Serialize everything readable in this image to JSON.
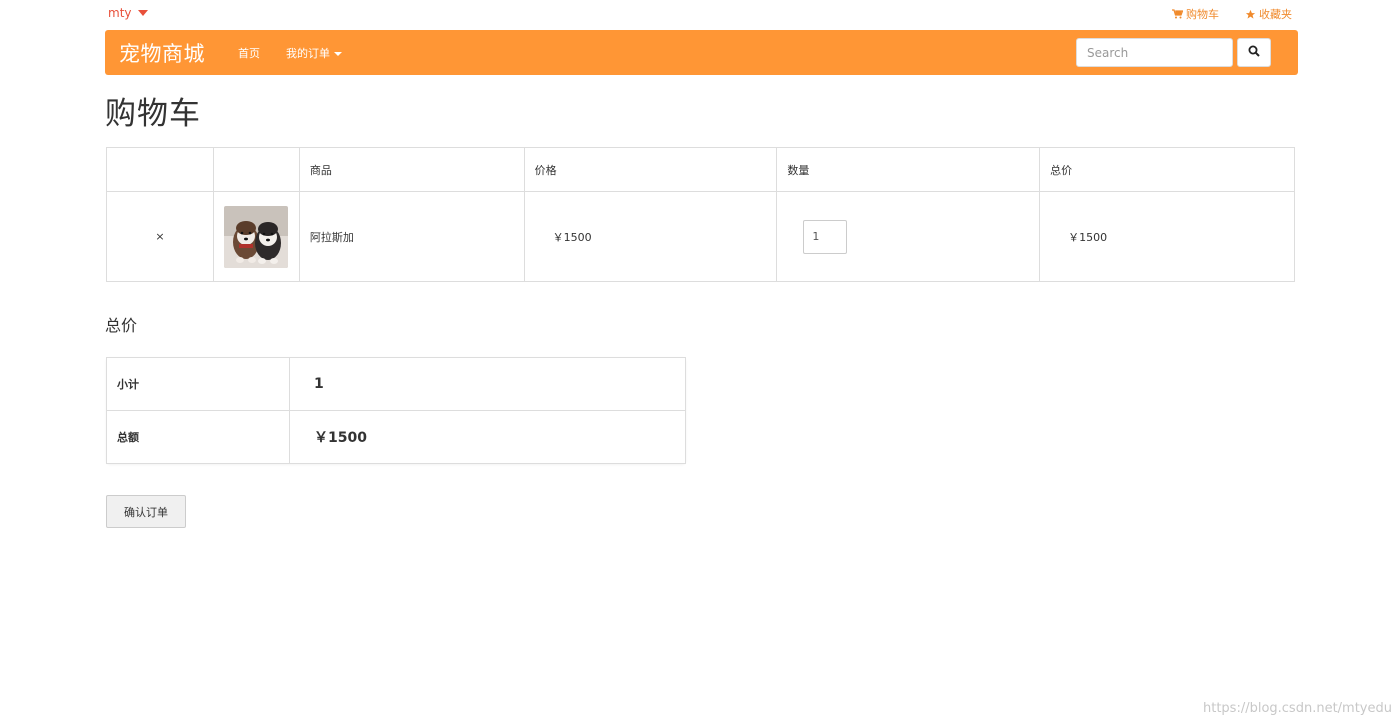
{
  "topbar": {
    "username": "mty",
    "cart_link": "购物车",
    "favorites_link": "收藏夹"
  },
  "navbar": {
    "brand": "宠物商城",
    "home": "首页",
    "orders": "我的订单",
    "search_placeholder": "Search"
  },
  "page_title": "购物车",
  "cart_table": {
    "headers": [
      "",
      "",
      "商品",
      "价格",
      "数量",
      "总价"
    ],
    "rows": [
      {
        "remove_icon": "×",
        "product_name": "阿拉斯加",
        "price": "￥1500",
        "quantity": "1",
        "total": "￥1500"
      }
    ]
  },
  "summary": {
    "title": "总价",
    "subtotal_label": "小计",
    "subtotal_value": "1",
    "total_label": "总额",
    "total_value": "￥1500"
  },
  "confirm_button": "确认订单",
  "watermark": "https://blog.csdn.net/mtyedu",
  "colors": {
    "navbar": "#ff9635",
    "accent_link": "#f08a2c",
    "user_link": "#e8503a",
    "remove": "#d9534f"
  },
  "icons": {
    "cart": "shopping-cart-icon",
    "favorites": "star-icon",
    "search": "magnifier-icon"
  }
}
